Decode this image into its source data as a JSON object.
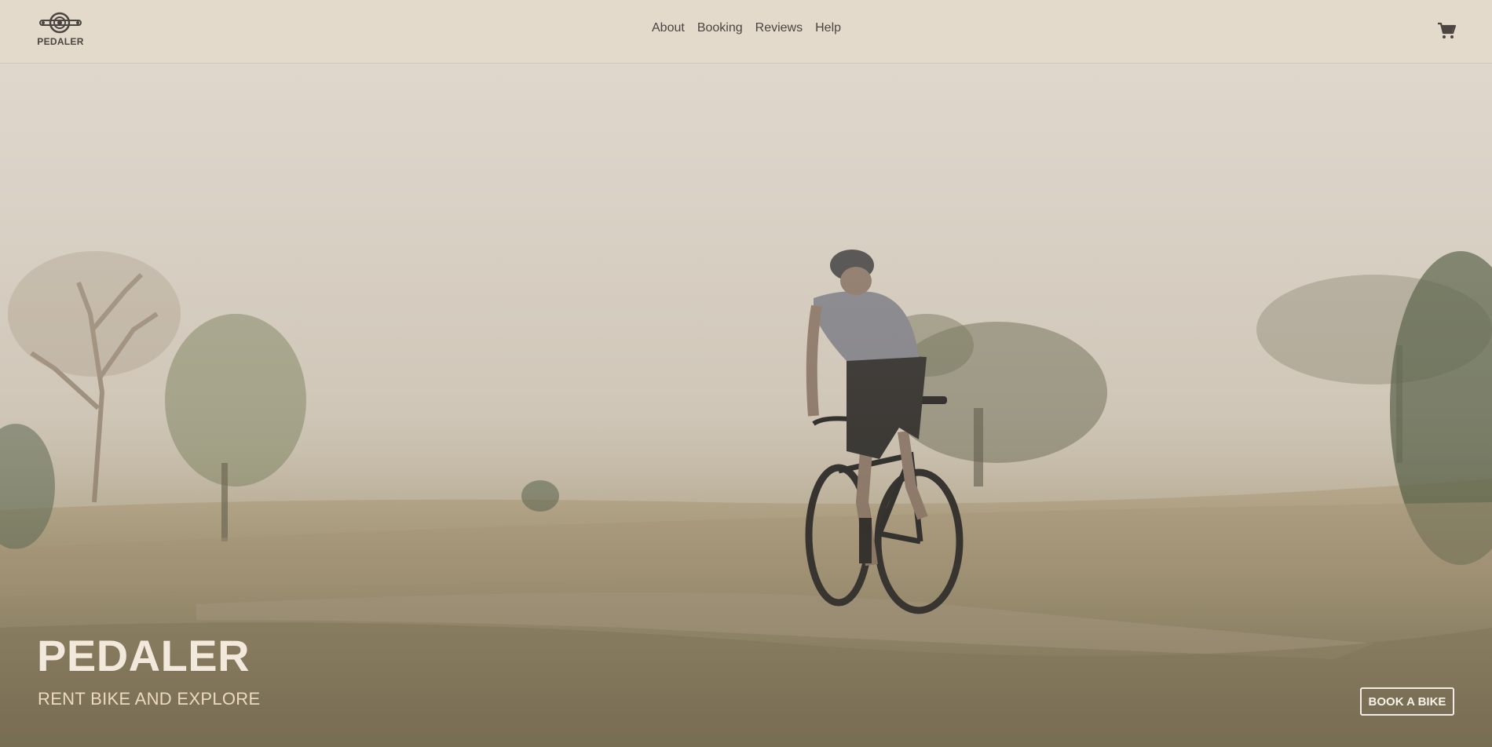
{
  "brand": {
    "name": "PEDALER",
    "logo_icon": "bike-crank-logo-icon"
  },
  "nav": {
    "links": [
      {
        "label": "About"
      },
      {
        "label": "Booking"
      },
      {
        "label": "Reviews"
      },
      {
        "label": "Help"
      }
    ],
    "cart_icon": "cart-icon"
  },
  "hero": {
    "title": "PEDALER",
    "subtitle": "RENT BIKE AND EXPLORE",
    "cta_label": "BOOK A BIKE",
    "image_subject": "cyclist riding on a trail through grassy field with trees"
  },
  "colors": {
    "nav_bg": "#e4dacc",
    "nav_text": "#4a4540",
    "hero_title": "#f2e9dc",
    "hero_subtitle": "#ecd9bf",
    "cta_border": "#f3ece2"
  }
}
